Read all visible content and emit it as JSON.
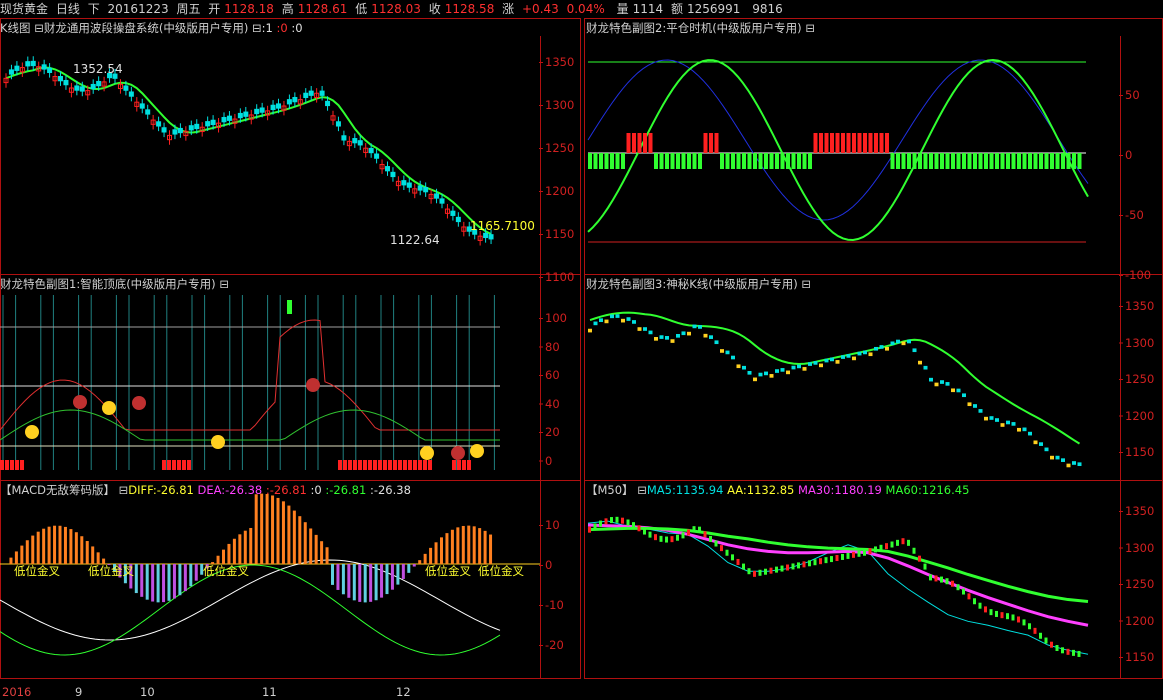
{
  "header": {
    "name": "现货黄金",
    "period": "日线",
    "dir": "下",
    "date": "20161223",
    "weekday": "周五",
    "open_label": "开",
    "open": "1128.18",
    "high_label": "高",
    "high": "1128.61",
    "low_label": "低",
    "low": "1128.03",
    "close_label": "收",
    "close": "1128.58",
    "chg_label": "涨",
    "chg": "+0.43",
    "chg_pct": "0.04%",
    "vol_label": "量",
    "vol": "1114",
    "amt_label": "额",
    "amt": "1256991",
    "extra": "9816"
  },
  "panels": {
    "kline": {
      "title": "K线图",
      "system": "财龙通用波段操盘系统(中级版用户专用)",
      "flag1": ":1",
      "flag2": ":0",
      "flag3": ":0",
      "label_high": "1352.54",
      "label_low": "1122.64",
      "label_ma": "1165.7100",
      "yticks": [
        "1350",
        "1300",
        "1250",
        "1200",
        "1150",
        "1100"
      ]
    },
    "sub1": {
      "title": "财龙特色副图1:智能顶底(中级版用户专用)",
      "yticks": [
        "100",
        "80",
        "60",
        "40",
        "20",
        "0"
      ]
    },
    "sub2": {
      "title": "财龙特色副图2:平仓时机(中级版用户专用)",
      "yticks": [
        "50",
        "0",
        "-50",
        "-100"
      ]
    },
    "sub3": {
      "title": "财龙特色副图3:神秘K线(中级版用户专用)",
      "yticks": [
        "1350",
        "1300",
        "1250",
        "1200",
        "1150"
      ]
    },
    "macd": {
      "title": "【MACD无敌筹码版】",
      "diff_label": "DIFF:",
      "diff": "-26.81",
      "dea_label": "DEA:",
      "dea": "-26.38",
      "v1": ":-26.81",
      "v2": ":0",
      "v3": ":-26.81",
      "v4": ":-26.38",
      "yticks": [
        "10",
        "0",
        "-10",
        "-20"
      ],
      "annotations": [
        "低位金叉",
        "低位金叉",
        "低位金叉",
        "低位金叉",
        "低位金叉"
      ]
    },
    "ma": {
      "title": "【M50】",
      "ma5_label": "MA5:",
      "ma5": "1135.94",
      "aa_label": "AA:",
      "aa": "1132.85",
      "ma30_label": "MA30:",
      "ma30": "1180.19",
      "ma60_label": "MA60:",
      "ma60": "1216.45",
      "yticks": [
        "1350",
        "1300",
        "1250",
        "1200",
        "1150"
      ]
    }
  },
  "xaxis": [
    "2016",
    "9",
    "10",
    "11",
    "12"
  ],
  "colors": {
    "up": "#ff2020",
    "down": "#00e0e0",
    "ma_green": "#30ff30",
    "axis_red": "#c01010",
    "bg": "#000000"
  },
  "chart_data": {
    "type": "line",
    "title": "",
    "series": [
      {
        "name": "MA5",
        "values": [
          1335,
          1338,
          1330,
          1326,
          1320,
          1318,
          1300,
          1275,
          1262,
          1262,
          1266,
          1276,
          1290,
          1302,
          1292,
          1258,
          1235,
          1215,
          1196,
          1186,
          1180,
          1172,
          1165,
          1150,
          1142,
          1136
        ]
      },
      {
        "name": "MA30",
        "values": [
          1332,
          1331,
          1330,
          1328,
          1324,
          1318,
          1310,
          1302,
          1296,
          1292,
          1290,
          1290,
          1291,
          1292,
          1290,
          1282,
          1270,
          1257,
          1245,
          1233,
          1222,
          1212,
          1202,
          1193,
          1186,
          1180
        ]
      },
      {
        "name": "MA60",
        "values": [
          1325,
          1326,
          1327,
          1327,
          1326,
          1324,
          1320,
          1315,
          1311,
          1306,
          1302,
          1299,
          1297,
          1296,
          1295,
          1292,
          1285,
          1276,
          1267,
          1257,
          1248,
          1239,
          1231,
          1224,
          1219,
          1216
        ]
      }
    ],
    "x": [
      "2016",
      "",
      "9",
      "",
      "",
      "10",
      "",
      "",
      "",
      "",
      "",
      "11",
      "",
      "",
      "",
      "",
      "",
      "",
      "12",
      "",
      "",
      "",
      "",
      "",
      "",
      ""
    ],
    "ylim": [
      1100,
      1370
    ]
  }
}
